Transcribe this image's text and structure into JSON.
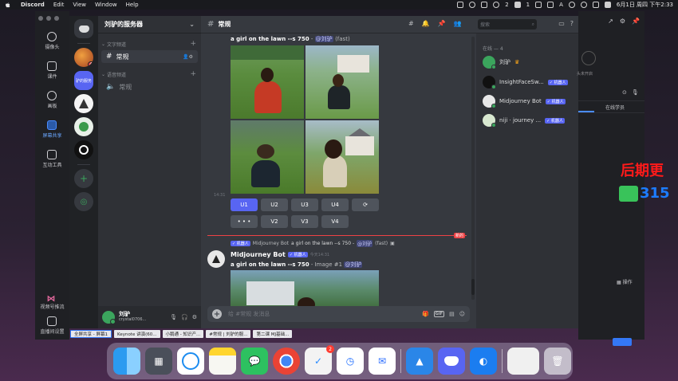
{
  "menubar": {
    "app_name": "Discord",
    "menus": [
      "Edit",
      "View",
      "Window",
      "Help"
    ],
    "status_items": [
      "2",
      "1",
      "A"
    ],
    "clock": "6月1日 周四 下午2:33"
  },
  "classroom_sidebar": {
    "items": [
      {
        "label": "摄像头",
        "icon": "camera-icon"
      },
      {
        "label": "课件",
        "icon": "courseware-icon"
      },
      {
        "label": "画板",
        "icon": "palette-icon"
      },
      {
        "label": "屏幕共享",
        "icon": "screen-share-icon"
      },
      {
        "label": "互动工具",
        "icon": "toolbox-icon"
      }
    ],
    "bottom_items": [
      {
        "label": "视频号推流",
        "icon": "video-stream-icon"
      },
      {
        "label": "直播间设置",
        "icon": "live-settings-icon"
      }
    ]
  },
  "servers": {
    "unread_badge": "4"
  },
  "server_name": "刘驴的服务器",
  "categories": {
    "text": "文字频道",
    "voice": "语音频道"
  },
  "channels": {
    "text_active": "常规",
    "voice": "常规"
  },
  "user": {
    "name": "刘驴",
    "tag": "crystal0706..."
  },
  "chat": {
    "channel_name": "常规",
    "msg1": {
      "prompt": "a girl on the lawn --s 750",
      "separator": " - ",
      "mention": "@刘驴",
      "mode": "(fast)",
      "time": "14:31"
    },
    "buttons_row1": [
      "U1",
      "U2",
      "U3",
      "U4",
      "⟳"
    ],
    "buttons_row2": [
      "• • •",
      "V2",
      "V3",
      "V4"
    ],
    "new_tag": "新的",
    "reply": {
      "bot_tag": "✓ 机器人",
      "author": "Midjourney Bot",
      "text": "a girl on the lawn --s 750 -",
      "mention": "@刘驴",
      "mode": "(fast)"
    },
    "msg2": {
      "author": "Midjourney Bot",
      "bot_tag": "✓ 机器人",
      "time": "今天14:31",
      "prompt": "a girl on the lawn --s 750",
      "suffix": " - Image #1 ",
      "mention": "@刘驴"
    },
    "composer_placeholder": "给 #常规 发消息"
  },
  "members": {
    "search_placeholder": "搜索",
    "online_label": "在线 — 4",
    "list": [
      {
        "name": "刘驴",
        "bot": false
      },
      {
        "name": "InsightFaceSw...",
        "bot": true
      },
      {
        "name": "Midjourney Bot",
        "bot": true
      },
      {
        "name": "niji · journey ...",
        "bot": true
      }
    ],
    "bot_tag": "✓ 机器人"
  },
  "right_panel": {
    "camera_text": "头未开启",
    "tab_right": "在线学员",
    "ops": "操作"
  },
  "overlay": {
    "red_text": "后期更",
    "blue_number": "315"
  },
  "taskstrip": [
    "全屏共享 - 屏幕1",
    "Keynote 讲演(60...",
    "小鹅通 - 知识产...",
    "#常规 | 刘驴的服...",
    "第二课 MJ基础..."
  ],
  "dock": {
    "tick_badge": "2"
  }
}
